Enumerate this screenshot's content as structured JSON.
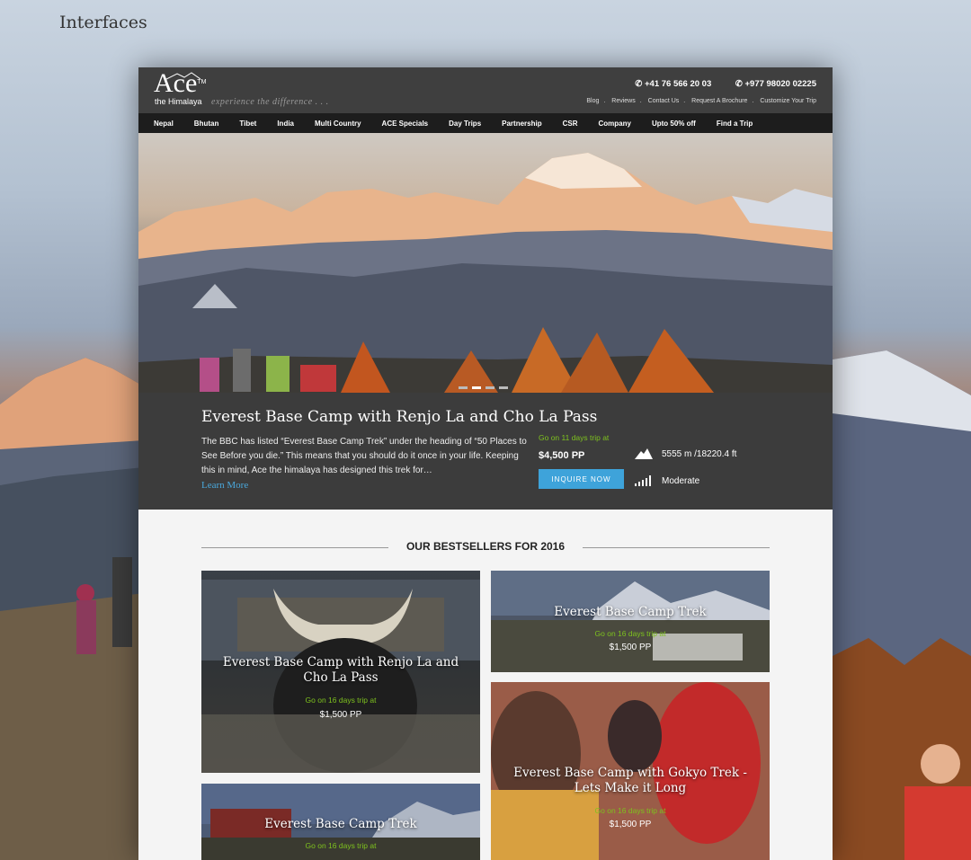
{
  "caption": "Interfaces",
  "header": {
    "logo_main": "Ace",
    "logo_tm": "TM",
    "logo_sub": "the Himalaya",
    "tagline": "experience the difference . . .",
    "phone_1": "+41 76 566 20 03",
    "phone_2": "+977 98020 02225",
    "links": [
      "Blog",
      "Reviews",
      "Contact Us",
      "Request A Brochure",
      "Customize Your Trip"
    ]
  },
  "nav": [
    "Nepal",
    "Bhutan",
    "Tibet",
    "India",
    "Multi Country",
    "ACE Specials",
    "Day Trips",
    "Partnership",
    "CSR",
    "Company",
    "Upto 50% off",
    "Find a Trip"
  ],
  "slider": {
    "count": 4,
    "active": 1
  },
  "featured": {
    "title": "Everest Base Camp with Renjo La and Cho La Pass",
    "description": "The BBC has listed “Everest Base Camp Trek” under the heading of “50 Places to See Before you die.” This means that you should do it once in your life. Keeping this in mind, Ace the himalaya has designed this trek for…",
    "learn_more": "Learn More",
    "go_on": "Go on 11 days trip at",
    "price": "$4,500 PP",
    "inquire": "INQUIRE NOW",
    "altitude": "5555 m /18220.4 ft",
    "difficulty": "Moderate"
  },
  "bestsellers": {
    "heading": "OUR BESTSELLERS FOR 2016",
    "tiles": [
      {
        "title": "Everest Base Camp with Renjo La and Cho La Pass",
        "go": "Go on 16 days trip at",
        "price": "$1,500 PP"
      },
      {
        "title": "Everest Base Camp Trek",
        "go": "Go on 16 days trip at",
        "price": "$1,500 PP"
      },
      {
        "title": "Everest Base Camp with Gokyo Trek - Lets Make it Long",
        "go": "Go on 16 days trip at",
        "price": "$1,500 PP"
      },
      {
        "title": "Everest Base Camp Trek",
        "go": "Go on 16 days trip at",
        "price": ""
      }
    ]
  }
}
